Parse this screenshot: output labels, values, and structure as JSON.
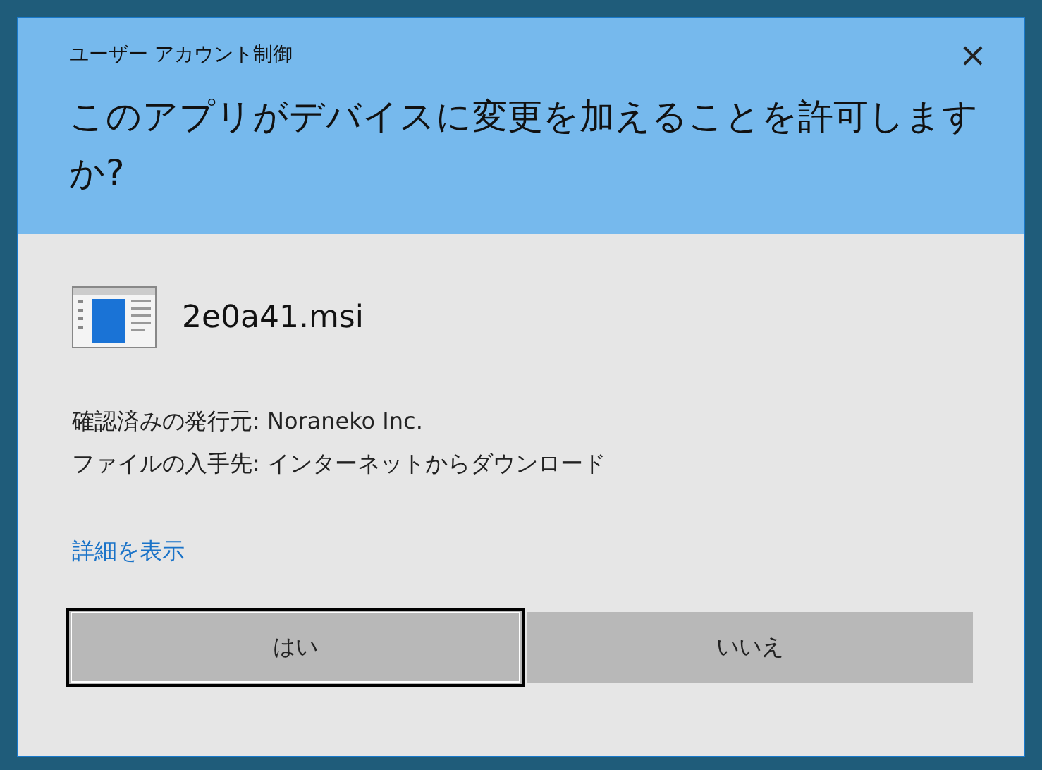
{
  "window": {
    "title": "ユーザー アカウント制御",
    "close": "×"
  },
  "question": "このアプリがデバイスに変更を加えることを許可しますか?",
  "program": {
    "file_name": "2e0a41.msi"
  },
  "details": [
    "確認済みの発行元: Noraneko Inc.",
    "ファイルの入手先: インターネットからダウンロード"
  ],
  "more_link": "詳細を表示",
  "buttons": [
    {
      "label": "はい",
      "focused": true
    },
    {
      "label": "いいえ",
      "focused": false
    }
  ]
}
